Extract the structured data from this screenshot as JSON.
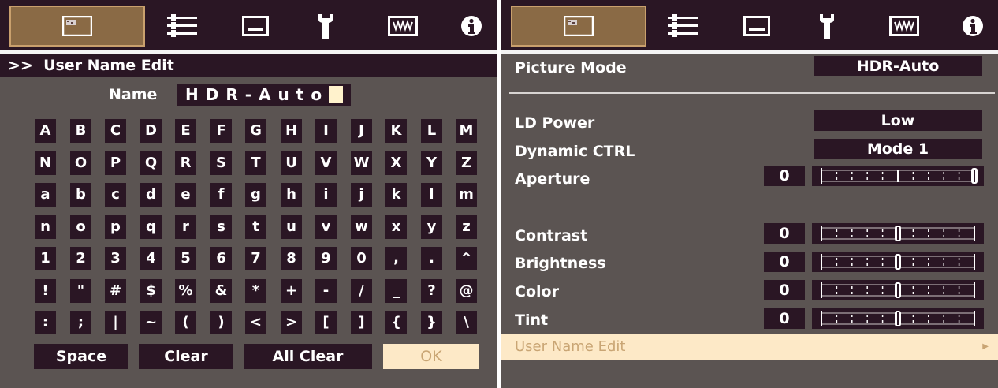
{
  "colors": {
    "panel_bg": "#5b5452",
    "dark_box": "#2a1624",
    "active_tab": "#8a6a45",
    "highlight": "#fde9c7",
    "highlight_text": "#c9a574"
  },
  "icon_tabs": [
    {
      "icon": "picture-icon",
      "active": true
    },
    {
      "icon": "adjust-sliders-icon",
      "active": false
    },
    {
      "icon": "display-screen-icon",
      "active": false
    },
    {
      "icon": "wrench-icon",
      "active": false
    },
    {
      "icon": "keystone-grid-icon",
      "active": false
    },
    {
      "icon": "info-icon",
      "active": false
    }
  ],
  "left": {
    "breadcrumb": ">>  User Name Edit",
    "name_label": "Name",
    "name_value": "HDR-Auto",
    "keyboard": [
      [
        "A",
        "B",
        "C",
        "D",
        "E",
        "F",
        "G",
        "H",
        "I",
        "J",
        "K",
        "L",
        "M"
      ],
      [
        "N",
        "O",
        "P",
        "Q",
        "R",
        "S",
        "T",
        "U",
        "V",
        "W",
        "X",
        "Y",
        "Z"
      ],
      [
        "a",
        "b",
        "c",
        "d",
        "e",
        "f",
        "g",
        "h",
        "i",
        "j",
        "k",
        "l",
        "m"
      ],
      [
        "n",
        "o",
        "p",
        "q",
        "r",
        "s",
        "t",
        "u",
        "v",
        "w",
        "x",
        "y",
        "z"
      ],
      [
        "1",
        "2",
        "3",
        "4",
        "5",
        "6",
        "7",
        "8",
        "9",
        "0",
        ",",
        ".",
        "^"
      ],
      [
        "!",
        "\"",
        "#",
        "$",
        "%",
        "&",
        "*",
        "+",
        "-",
        "/",
        "_",
        "?",
        "@"
      ],
      [
        ":",
        ";",
        "|",
        "~",
        "(",
        ")",
        "<",
        ">",
        "[",
        "]",
        "{",
        "}",
        "\\"
      ]
    ],
    "buttons": {
      "space": "Space",
      "clear": "Clear",
      "all_clear": "All Clear",
      "ok": "OK"
    }
  },
  "right": {
    "picture_mode": {
      "label": "Picture Mode",
      "value": "HDR-Auto"
    },
    "ld_power": {
      "label": "LD Power",
      "value": "Low"
    },
    "dynamic_ctrl": {
      "label": "Dynamic CTRL",
      "value": "Mode 1"
    },
    "aperture": {
      "label": "Aperture",
      "value": "0",
      "slider_level": 1.0
    },
    "contrast": {
      "label": "Contrast",
      "value": "0",
      "slider_level": 0.5
    },
    "brightness": {
      "label": "Brightness",
      "value": "0",
      "slider_level": 0.5
    },
    "color": {
      "label": "Color",
      "value": "0",
      "slider_level": 0.5
    },
    "tint": {
      "label": "Tint",
      "value": "0",
      "slider_level": 0.5
    },
    "user_name_edit": {
      "label": "User Name Edit"
    }
  }
}
